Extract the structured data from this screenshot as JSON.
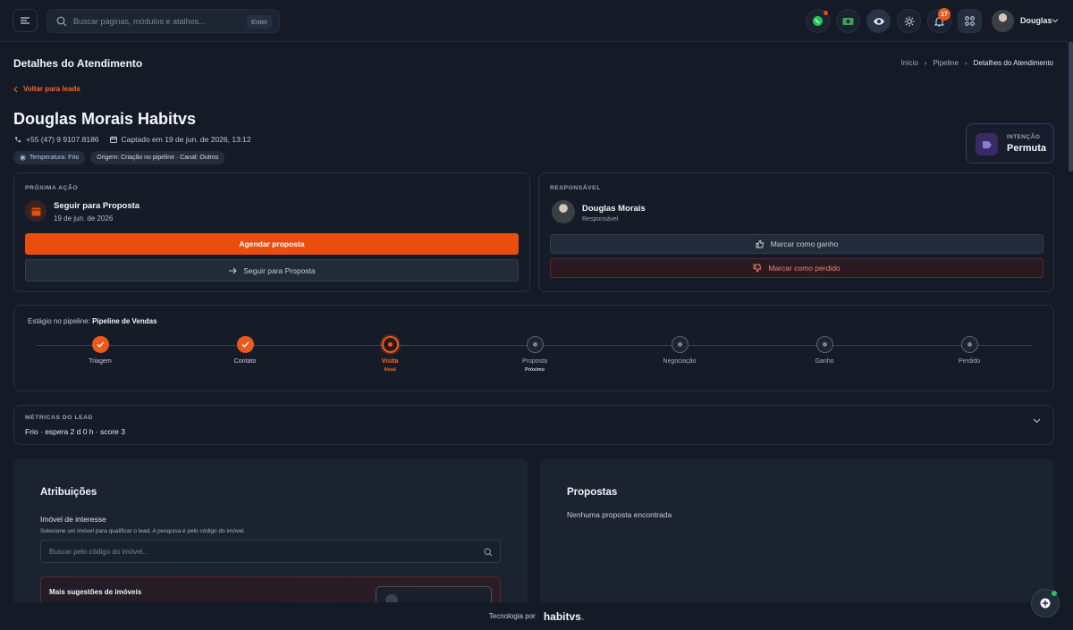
{
  "search": {
    "placeholder": "Buscar páginas, módulos e atalhos...",
    "key_hint": "Enter"
  },
  "header": {
    "notification_count": "17",
    "user_name": "Douglas"
  },
  "page": {
    "title": "Detalhes do Atendimento"
  },
  "breadcrumb": {
    "items": [
      "Início",
      "Pipeline",
      "Detalhes do Atendimento"
    ]
  },
  "back_link": "Voltar para leads",
  "lead": {
    "name": "Douglas Morais Habitvs",
    "phone": "+55 (47) 9 9107.8186",
    "captured": "Captado em 19 de jun. de 2026, 13:12",
    "tags": [
      "Temperatura: Frio",
      "Origem: Criação no pipeline · Canal: Outros"
    ]
  },
  "intent": {
    "label": "INTENÇÃO",
    "value": "Permuta"
  },
  "next_action": {
    "section": "PRÓXIMA AÇÃO",
    "title": "Seguir para Proposta",
    "date": "19 de jun. de 2026",
    "primary_button": "Agendar proposta",
    "secondary_button": "Seguir para Proposta"
  },
  "responsible": {
    "section": "RESPONSÁVEL",
    "name": "Douglas Morais",
    "role": "Responsável",
    "won_button": "Marcar como ganho",
    "lost_button": "Marcar como perdido"
  },
  "pipeline": {
    "label": "Estágio no pipeline:",
    "name": "Pipeline de Vendas",
    "stages": [
      {
        "name": "Triagem",
        "status": "done",
        "sub": ""
      },
      {
        "name": "Contato",
        "status": "done",
        "sub": ""
      },
      {
        "name": "Visita",
        "status": "current",
        "sub": "Atual"
      },
      {
        "name": "Proposta",
        "status": "next",
        "sub": "Próximo"
      },
      {
        "name": "Negociação",
        "status": "pending",
        "sub": ""
      },
      {
        "name": "Ganho",
        "status": "pending",
        "sub": ""
      },
      {
        "name": "Perdido",
        "status": "pending",
        "sub": ""
      }
    ]
  },
  "metrics": {
    "section": "MÉTRICAS DO LEAD",
    "summary": "Frio · espera 2 d 0 h · score 3"
  },
  "assignments": {
    "title": "Atribuições",
    "field_label": "Imóvel de interesse",
    "field_help": "Selecione um imóvel para qualificar o lead. A pesquisa é pelo código do imóvel.",
    "search_placeholder": "Buscar pelo código do imóvel...",
    "suggestions_title": "Mais sugestões de imóveis"
  },
  "proposals": {
    "title": "Propostas",
    "empty": "Nenhuma proposta encontrada"
  },
  "footer": {
    "text": "Tecnologia por",
    "brand": "habitvs"
  },
  "colors": {
    "accent": "#ea4e0f",
    "background": "#141b27",
    "card": "#151c28"
  }
}
